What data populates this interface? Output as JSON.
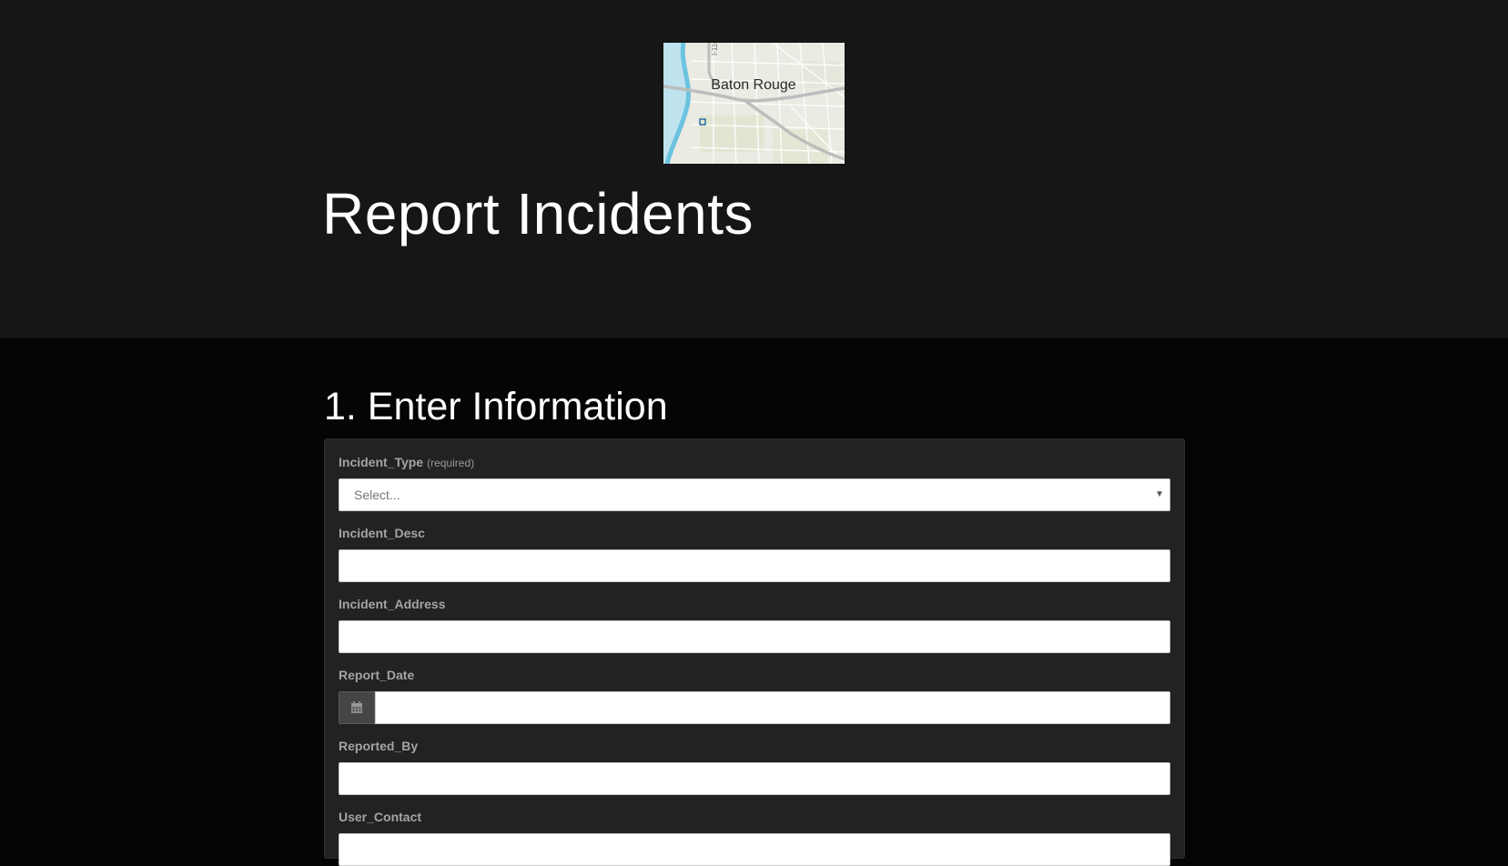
{
  "header": {
    "map_label": "Baton Rouge",
    "map_road_label": "I-110",
    "page_title": "Report Incidents"
  },
  "section": {
    "title": "1. Enter Information"
  },
  "form": {
    "fields": [
      {
        "label": "Incident_Type",
        "required_tag": "(required)",
        "type": "select",
        "placeholder": "Select..."
      },
      {
        "label": "Incident_Desc",
        "type": "text",
        "value": ""
      },
      {
        "label": "Incident_Address",
        "type": "text",
        "value": ""
      },
      {
        "label": "Report_Date",
        "type": "date",
        "value": "",
        "icon": "calendar-icon"
      },
      {
        "label": "Reported_By",
        "type": "text",
        "value": ""
      },
      {
        "label": "User_Contact",
        "type": "text",
        "value": ""
      }
    ]
  },
  "colors": {
    "header_bg": "#161616",
    "page_bg": "#050505",
    "panel_bg": "#222222",
    "label_color": "#a4a4a4"
  }
}
